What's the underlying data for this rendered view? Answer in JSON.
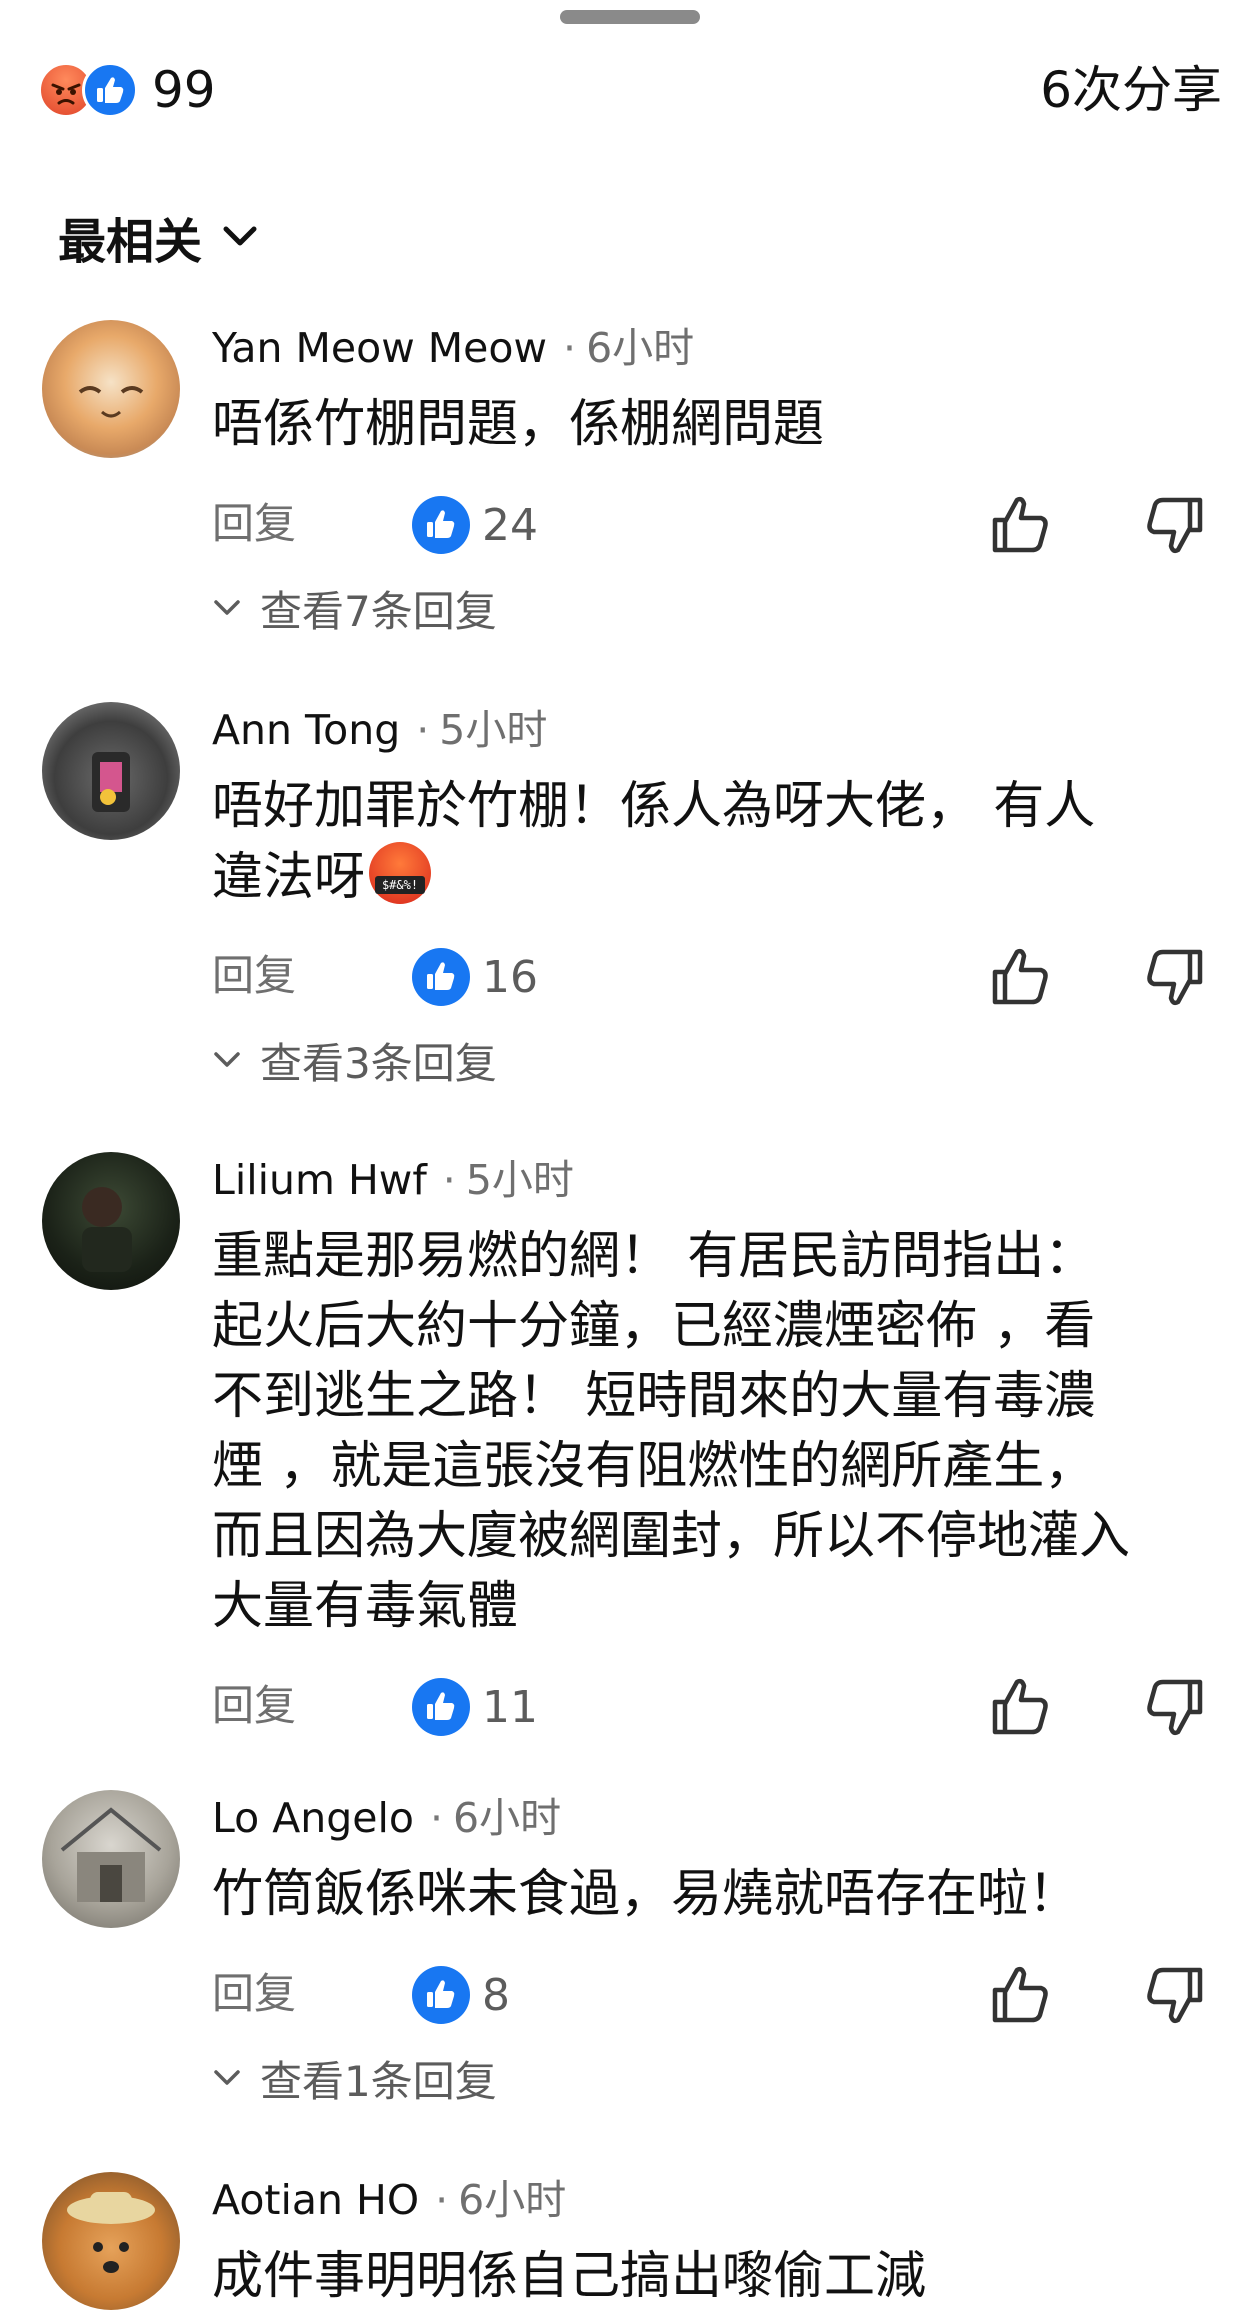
{
  "header": {
    "reaction_count": "99",
    "share_label": "6次分享",
    "reaction_icons": [
      "angry-react-icon",
      "like-react-icon"
    ]
  },
  "sort": {
    "label": "最相关"
  },
  "comments": [
    {
      "author": "Yan Meow Meow",
      "time": "6小时",
      "text": "唔係竹棚問題，係棚網問題",
      "reply_label": "回复",
      "likes": "24",
      "view_replies": "查看7条回复"
    },
    {
      "author": "Ann Tong",
      "time": "5小时",
      "text_line1": "唔好加罪於竹棚！係人為呀大佬， 有人",
      "text_line2": "違法呀",
      "emoji": "$#&%!",
      "reply_label": "回复",
      "likes": "16",
      "view_replies": "查看3条回复"
    },
    {
      "author": "Lilium Hwf",
      "time": "5小时",
      "lines": [
        "重點是那易燃的網！ 有居民訪問指出：",
        "起火后大約十分鐘，已經濃煙密佈 ，看",
        "不到逃生之路！ 短時間來的大量有毒濃",
        "煙 ，就是這張沒有阻燃性的網所產生，",
        "而且因為大廈被網圍封，所以不停地灌入",
        "大量有毒氣體"
      ],
      "reply_label": "回复",
      "likes": "11"
    },
    {
      "author": "Lo Angelo",
      "time": "6小时",
      "text": "竹筒飯係咪未食過，易燒就唔存在啦！",
      "reply_label": "回复",
      "likes": "8",
      "view_replies": "查看1条回复"
    },
    {
      "author": "Aotian HO",
      "time": "6小时",
      "text": "成件事明明係自己搞出嚟偷工減"
    }
  ],
  "colors": {
    "accent": "#1877f2",
    "angry": "#e0452a"
  }
}
